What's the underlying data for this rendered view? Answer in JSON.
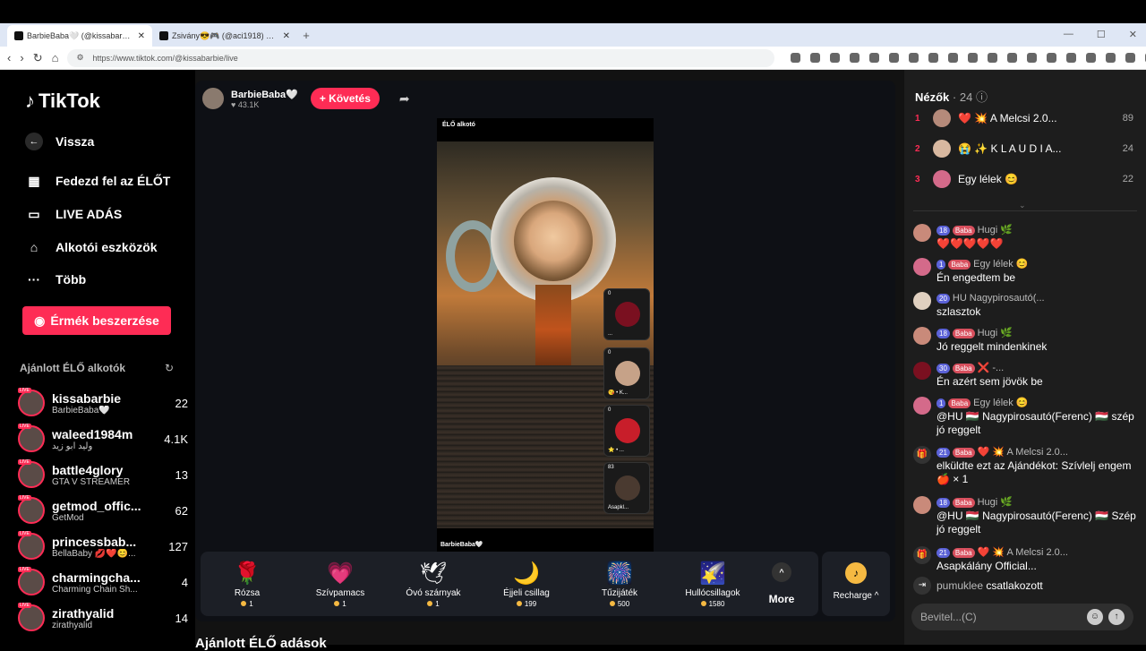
{
  "browser": {
    "tabs": [
      {
        "label": "BarbieBaba🤍 (@kissabarbie...",
        "active": true
      },
      {
        "label": "Zsivány😎🎮 (@aci1918) ÉLŐ adás...",
        "active": false
      }
    ],
    "url": "https://www.tiktok.com/@kissabarbie/live"
  },
  "sidebar": {
    "logo": "TikTok",
    "back": "Vissza",
    "items": [
      {
        "label": "Fedezd fel az ÉLŐT",
        "icon": "calendar-icon"
      },
      {
        "label": "LIVE ADÁS",
        "icon": "video-camera-icon"
      },
      {
        "label": "Alkotói eszközök",
        "icon": "creator-tools-icon"
      },
      {
        "label": "Több",
        "icon": "more-icon"
      }
    ],
    "coins_button": "Érmék beszerzése",
    "suggested_title": "Ajánlott ÉLŐ alkotók",
    "creators": [
      {
        "name": "kissabarbie",
        "sub": "BarbieBaba🤍",
        "count": "22"
      },
      {
        "name": "waleed1984m",
        "sub": "وليد ابو زيد",
        "count": "4.1K"
      },
      {
        "name": "battle4glory",
        "sub": "GTA V STREAMER",
        "count": "13"
      },
      {
        "name": "getmod_offic...",
        "sub": "GetMod",
        "count": "62"
      },
      {
        "name": "princessbab...",
        "sub": "BellaBaby 💋❤️😊...",
        "count": "127"
      },
      {
        "name": "charmingcha...",
        "sub": "Charming Chain Sh...",
        "count": "4"
      },
      {
        "name": "zirathyalid",
        "sub": "zirathyalid",
        "count": "14"
      }
    ],
    "live_tag": "LIVE"
  },
  "stream": {
    "host_name": "BarbieBaba🤍",
    "host_likes": "♥ 43.1K",
    "follow": "+ Követés",
    "video_tag": "ÉLŐ alkotó",
    "video_bottom": "BarbieBaba🤍",
    "cohosts": [
      {
        "count": "0",
        "label": "..."
      },
      {
        "count": "0",
        "label": "😘 • K..."
      },
      {
        "count": "0",
        "label": "⭐ • ..."
      },
      {
        "count": "83",
        "label": "Asapkl..."
      }
    ]
  },
  "gifts": [
    {
      "name": "Rózsa",
      "price": "1",
      "icon": "🌹"
    },
    {
      "name": "Szívpamacs",
      "price": "1",
      "icon": "💗"
    },
    {
      "name": "Óvó szárnyak",
      "price": "1",
      "icon": "🕊"
    },
    {
      "name": "Éjjeli csillag",
      "price": "199",
      "icon": "🌙"
    },
    {
      "name": "Tűzijáték",
      "price": "500",
      "icon": "🎆"
    },
    {
      "name": "Hullócsillagok",
      "price": "1580",
      "icon": "🌠"
    }
  ],
  "more_label": "More",
  "recharge_label": "Recharge ^",
  "recommended_title": "Ajánlott ÉLŐ adások",
  "viewers": {
    "title": "Nézők",
    "count": "· 24",
    "list": [
      {
        "rank": "1",
        "name": "❤️ 💥 A Melcsi 2.0...",
        "score": "89"
      },
      {
        "rank": "2",
        "name": "😭 ✨ K L A U D I A...",
        "score": "24"
      },
      {
        "rank": "3",
        "name": "Egy lélek 😊",
        "score": "22"
      }
    ]
  },
  "chat": [
    {
      "badge": "18",
      "badge2": "Baba",
      "user": "Hugi 🌿",
      "text": "❤️❤️❤️❤️❤️"
    },
    {
      "badge": "1",
      "badge2": "Baba",
      "user": "Egy lélek 😊",
      "text": "Én engedtem be"
    },
    {
      "badge": "20",
      "badge2": "HU",
      "user": "Nagypirosautó(...",
      "text": "szlasztok"
    },
    {
      "badge": "18",
      "badge2": "Baba",
      "user": "Hugi 🌿",
      "text": "Jó reggelt mindenkinek"
    },
    {
      "badge": "30",
      "badge2": "Baba",
      "user": "❌ -...",
      "text": "Én azért sem jövök be"
    },
    {
      "badge": "1",
      "badge2": "Baba",
      "user": "Egy lélek 😊",
      "text": "@HU 🇭🇺 Nagypirosautó(Ferenc) 🇭🇺 szép jó reggelt"
    },
    {
      "badge": "21",
      "badge2": "Baba",
      "user": "❤️ 💥 A Melcsi 2.0...",
      "text": "elküldte ezt az Ajándékot: Szívlelj engem 🍎 × 1"
    },
    {
      "badge": "18",
      "badge2": "Baba",
      "user": "Hugi 🌿",
      "text": "@HU 🇭🇺 Nagypirosautó(Ferenc) 🇭🇺 Szép jó reggelt"
    },
    {
      "badge": "21",
      "badge2": "Baba",
      "user": "❤️ 💥 A Melcsi 2.0...",
      "text": "Asapkálány Official..."
    }
  ],
  "join": {
    "user": "pumuklee",
    "text": "csatlakozott"
  },
  "input_placeholder": "Bevitel...(C)"
}
